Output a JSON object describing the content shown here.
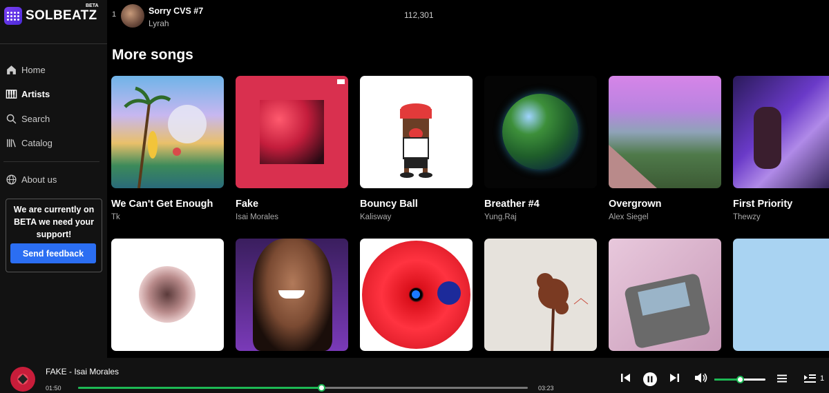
{
  "brand": {
    "name": "SOLBEATZ",
    "badge": "BETA"
  },
  "nav": {
    "items": [
      {
        "label": "Home",
        "icon": "home-icon",
        "active": false
      },
      {
        "label": "Artists",
        "icon": "piano-icon",
        "active": true
      },
      {
        "label": "Search",
        "icon": "search-icon",
        "active": false
      },
      {
        "label": "Catalog",
        "icon": "library-icon",
        "active": false
      }
    ],
    "about": {
      "label": "About us",
      "icon": "globe-icon"
    }
  },
  "beta_notice": {
    "message": "We are currently on BETA we need your support!",
    "button": "Send feedback"
  },
  "top_track": {
    "index": "1",
    "title": "Sorry CVS #7",
    "artist": "Lyrah",
    "plays": "112,301"
  },
  "section": {
    "title": "More songs"
  },
  "songs": [
    {
      "title": "We Can't Get Enough",
      "artist": "Tk"
    },
    {
      "title": "Fake",
      "artist": "Isai Morales"
    },
    {
      "title": "Bouncy Ball",
      "artist": "Kalisway"
    },
    {
      "title": "Breather #4",
      "artist": "Yung.Raj"
    },
    {
      "title": "Overgrown",
      "artist": "Alex Siegel"
    },
    {
      "title": "First Priority",
      "artist": "Thewzy"
    }
  ],
  "player": {
    "now_playing": "FAKE - Isai Morales",
    "current_time": "01:50",
    "duration": "03:23",
    "progress": 0.54,
    "volume": 0.5,
    "queue_count": "1"
  },
  "colors": {
    "accent": "#1db954",
    "button": "#2b6ef2",
    "sidebar": "#121212"
  }
}
